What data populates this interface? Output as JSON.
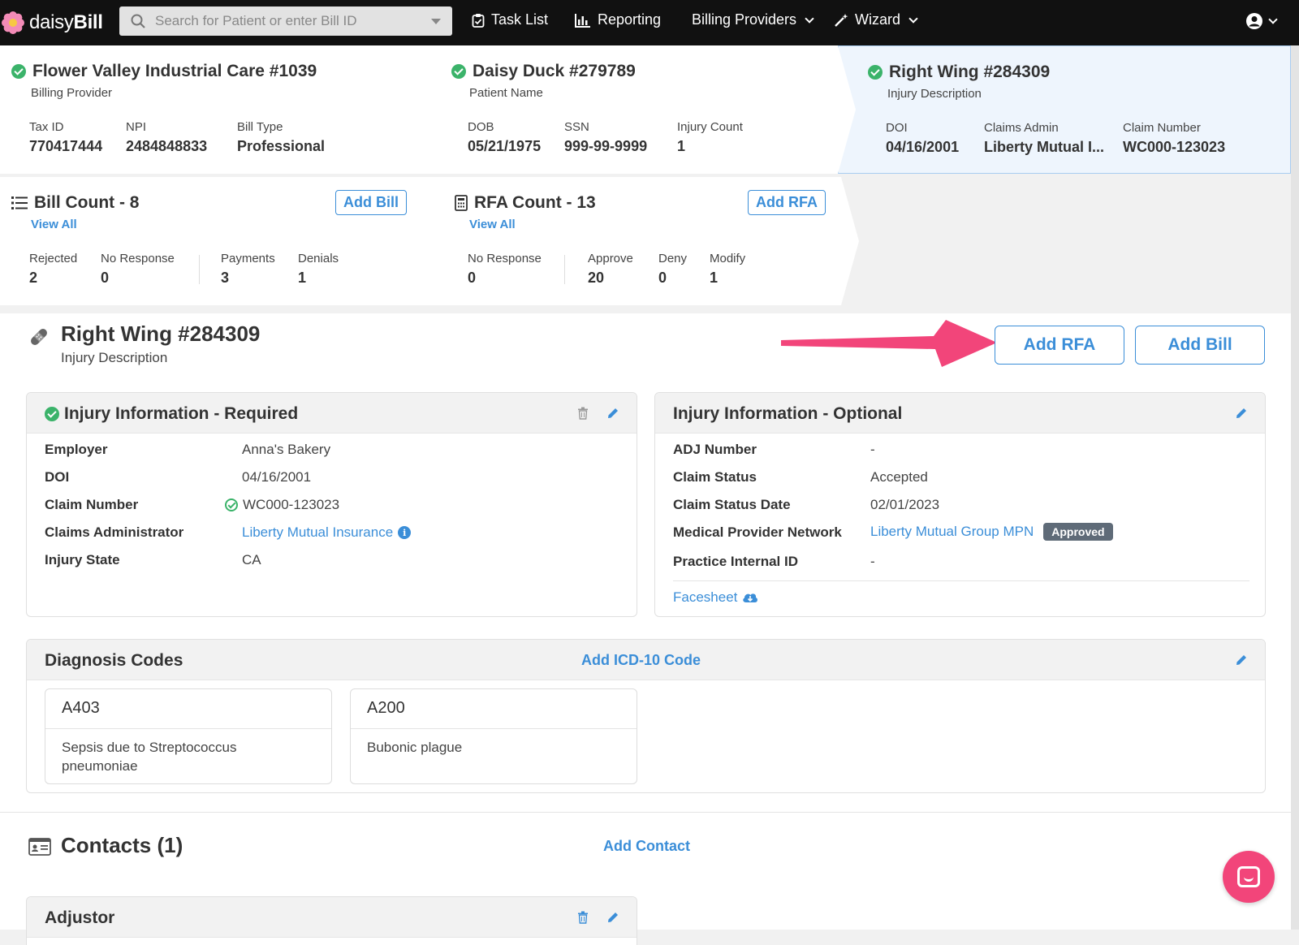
{
  "nav": {
    "logo_plain": "daisy",
    "logo_bold": "Bill",
    "search_placeholder": "Search for Patient or enter Bill ID",
    "task_list": "Task List",
    "reporting": "Reporting",
    "billing_providers": "Billing Providers",
    "wizard": "Wizard"
  },
  "provider": {
    "title": "Flower Valley Industrial Care #1039",
    "subtitle": "Billing Provider",
    "stats": [
      {
        "label": "Tax ID",
        "value": "770417444"
      },
      {
        "label": "NPI",
        "value": "2484848833"
      },
      {
        "label": "Bill Type",
        "value": "Professional"
      }
    ]
  },
  "patient": {
    "title": "Daisy Duck #279789",
    "subtitle": "Patient Name",
    "stats": [
      {
        "label": "DOB",
        "value": "05/21/1975"
      },
      {
        "label": "SSN",
        "value": "999-99-9999"
      },
      {
        "label": "Injury Count",
        "value": "1"
      }
    ]
  },
  "injury_card": {
    "title": "Right Wing #284309",
    "subtitle": "Injury Description",
    "stats": [
      {
        "label": "DOI",
        "value": "04/16/2001"
      },
      {
        "label": "Claims Admin",
        "value": "Liberty Mutual I..."
      },
      {
        "label": "Claim Number",
        "value": "WC000-123023"
      }
    ]
  },
  "bills": {
    "title": "Bill Count - 8",
    "view_all": "View All",
    "add_label": "Add Bill",
    "stats": [
      {
        "label": "Rejected",
        "value": "2"
      },
      {
        "label": "No Response",
        "value": "0"
      },
      {
        "label": "Payments",
        "value": "3"
      },
      {
        "label": "Denials",
        "value": "1"
      }
    ]
  },
  "rfas": {
    "title": "RFA Count - 13",
    "view_all": "View All",
    "add_label": "Add RFA",
    "stats": [
      {
        "label": "No Response",
        "value": "0"
      },
      {
        "label": "Approve",
        "value": "20"
      },
      {
        "label": "Deny",
        "value": "0"
      },
      {
        "label": "Modify",
        "value": "1"
      }
    ]
  },
  "injury": {
    "title": "Right Wing #284309",
    "subtitle": "Injury Description",
    "add_rfa": "Add RFA",
    "add_bill": "Add Bill"
  },
  "required": {
    "title": "Injury Information - Required",
    "rows": [
      {
        "label": "Employer",
        "value": "Anna's Bakery"
      },
      {
        "label": "DOI",
        "value": "04/16/2001"
      },
      {
        "label": "Claim Number",
        "value": "WC000-123023"
      },
      {
        "label": "Claims Administrator",
        "value": "Liberty Mutual Insurance"
      },
      {
        "label": "Injury State",
        "value": "CA"
      }
    ]
  },
  "optional": {
    "title": "Injury Information - Optional",
    "rows": [
      {
        "label": "ADJ Number",
        "value": "-"
      },
      {
        "label": "Claim Status",
        "value": "Accepted"
      },
      {
        "label": "Claim Status Date",
        "value": "02/01/2023"
      },
      {
        "label": "Medical Provider Network",
        "value": "Liberty Mutual Group MPN",
        "badge": "Approved"
      },
      {
        "label": "Practice Internal ID",
        "value": "-"
      }
    ],
    "facesheet": "Facesheet"
  },
  "diagnosis": {
    "title": "Diagnosis Codes",
    "add_label": "Add ICD-10 Code",
    "codes": [
      {
        "code": "A403",
        "desc": "Sepsis due to Streptococcus pneumoniae"
      },
      {
        "code": "A200",
        "desc": "Bubonic plague"
      }
    ]
  },
  "contacts": {
    "title": "Contacts (1)",
    "add_label": "Add Contact",
    "first_card": "Adjustor"
  },
  "colors": {
    "accent": "#3b8ed8",
    "success": "#3bb36a",
    "annotation_arrow": "#f2457a",
    "highlight_card": "#eef5fd"
  }
}
